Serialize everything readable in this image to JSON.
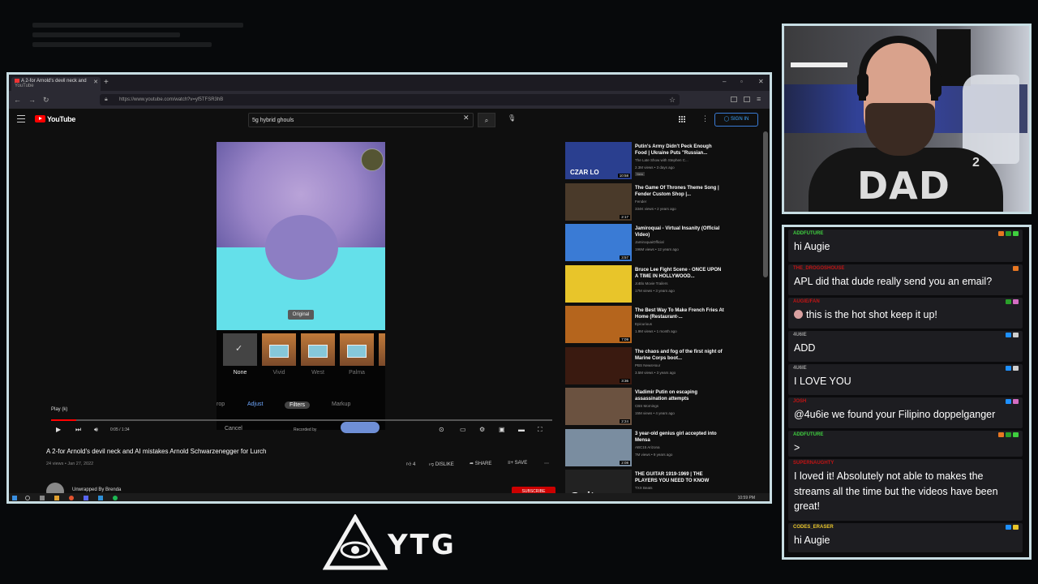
{
  "browser": {
    "tab_title": "A 2-for Arnold's devil neck and",
    "tab_sub": "YouTube",
    "url": "https://www.youtube.com/watch?v=yf5TFSR3hB"
  },
  "youtube": {
    "brand": "YouTube",
    "search_query": "5g hybrid ghouls",
    "sign_in": "SIGN IN"
  },
  "video": {
    "original_label": "Original",
    "filters": [
      {
        "label": "None",
        "selected": true
      },
      {
        "label": "Vivid",
        "selected": false
      },
      {
        "label": "West",
        "selected": false
      },
      {
        "label": "Palma",
        "selected": false
      }
    ],
    "edit_tabs": [
      "rop",
      "Adjust",
      "Filters",
      "Markup"
    ],
    "cancel": "Cancel",
    "recorded_by": "Recorded by",
    "play_tooltip": "Play (k)",
    "time": "0:05 / 1:34",
    "progress": 0.05,
    "title": "A 2-for Arnold's devil neck and AI mistakes Arnold Schwarzenegger for Lurch",
    "meta": "24 views • Jan 27, 2022",
    "likes": "4",
    "dislike": "DISLIKE",
    "share": "SHARE",
    "save": "SAVE",
    "channel": "Unwrapped By Brenda",
    "subscribe": "SUBSCRIBE"
  },
  "sidebar": [
    {
      "title": "Putin's Army Didn't Peck Enough Food | Ukraine Puts \"Russian...",
      "channel": "The Late Show with Stephen C...",
      "meta": "2.3M views • 3 days ago",
      "badge": "New",
      "duration": "10:58",
      "color": "#2a3f8f",
      "overlay": "CZAR LO"
    },
    {
      "title": "The Game Of Thrones Theme Song | Fender Custom Shop |...",
      "channel": "Fender",
      "meta": "334K views • 2 years ago",
      "duration": "2:17",
      "color": "#4a3a2a"
    },
    {
      "title": "Jamiroquai - Virtual Insanity (Official Video)",
      "channel": "JamiroquaiOfficial",
      "meta": "196M views • 12 years ago",
      "duration": "3:57",
      "color": "#3a7bd5"
    },
    {
      "title": "Bruce Lee Fight Scene - ONCE UPON A TIME IN HOLLYWOOD...",
      "channel": "JoBlo Movie Trailers",
      "meta": "17M views • 3 years ago",
      "duration": "",
      "color": "#e8c52a"
    },
    {
      "title": "The Best Way To Make French Fries At Home (Restaurant-...",
      "channel": "Epicurious",
      "meta": "1.9M views • 1 month ago",
      "duration": "7:09",
      "color": "#b5651d"
    },
    {
      "title": "The chaos and fog of the first night of Marine Corps boot...",
      "channel": "PBS NewsHour",
      "meta": "3.5M views • 3 years ago",
      "duration": "3:36",
      "color": "#3a1a10"
    },
    {
      "title": "Vladimir Putin on escaping assassination attempts",
      "channel": "CBS Mornings",
      "meta": "15M views • 4 years ago",
      "duration": "2:24",
      "color": "#6b5240"
    },
    {
      "title": "3 year-old genius girl accepted into Mensa",
      "channel": "ABC15 Arizona",
      "meta": "7M views • 9 years ago",
      "duration": "2:08",
      "color": "#7a8da0"
    },
    {
      "title": "THE GUITAR 1919-1969 | THE PLAYERS YOU NEED TO KNOW",
      "channel": "TXX Beats",
      "meta": "",
      "duration": "",
      "color": "#222",
      "overlay": "Guitar"
    }
  ],
  "taskbar": {
    "clock": "10:59 PM"
  },
  "chat": [
    {
      "user": "ADDFUTURE",
      "user_color": "#3fcf3f",
      "text": "hi Augie",
      "badges": [
        "#e87722",
        "#2aa02a",
        "#3fcf3f"
      ]
    },
    {
      "user": "THE_DROGOSHOUSE",
      "user_color": "#c21414",
      "text": "APL did that dude really send you an email?",
      "badges": [
        "#e87722"
      ]
    },
    {
      "user": "AUGIE/FAN",
      "user_color": "#c21414",
      "text": "this is the hot shot keep it up!",
      "emote": true,
      "badges": [
        "#2aa02a",
        "#d46cc2"
      ]
    },
    {
      "user": "4U6IE",
      "user_color": "#9a9a9a",
      "text": "ADD",
      "badges": [
        "#1e90ff",
        "#cfcfcf"
      ]
    },
    {
      "user": "4U6IE",
      "user_color": "#9a9a9a",
      "text": "I LOVE YOU",
      "badges": [
        "#1e90ff",
        "#cfcfcf"
      ]
    },
    {
      "user": "JOSH",
      "user_color": "#c21414",
      "text": "@4u6ie we found your Filipino doppelganger",
      "badges": [
        "#1e90ff",
        "#d46cc2"
      ]
    },
    {
      "user": "ADDFUTURE",
      "user_color": "#3fcf3f",
      "text": ">",
      "badges": [
        "#e87722",
        "#2aa02a",
        "#3fcf3f"
      ]
    },
    {
      "user": "SUPERNAUGHTY",
      "user_color": "#c21414",
      "text": "I loved it! Absolutely not able to makes the streams all the time but the videos have been great!",
      "badges": []
    },
    {
      "user": "CODES_ERASER",
      "user_color": "#e8c52a",
      "text": "hi Augie",
      "badges": [
        "#1e90ff",
        "#e8c52a"
      ]
    }
  ],
  "webcam": {
    "shirt_text": "DAD",
    "shirt_sup": "2"
  },
  "overlay_logo": {
    "text": "YTG"
  }
}
